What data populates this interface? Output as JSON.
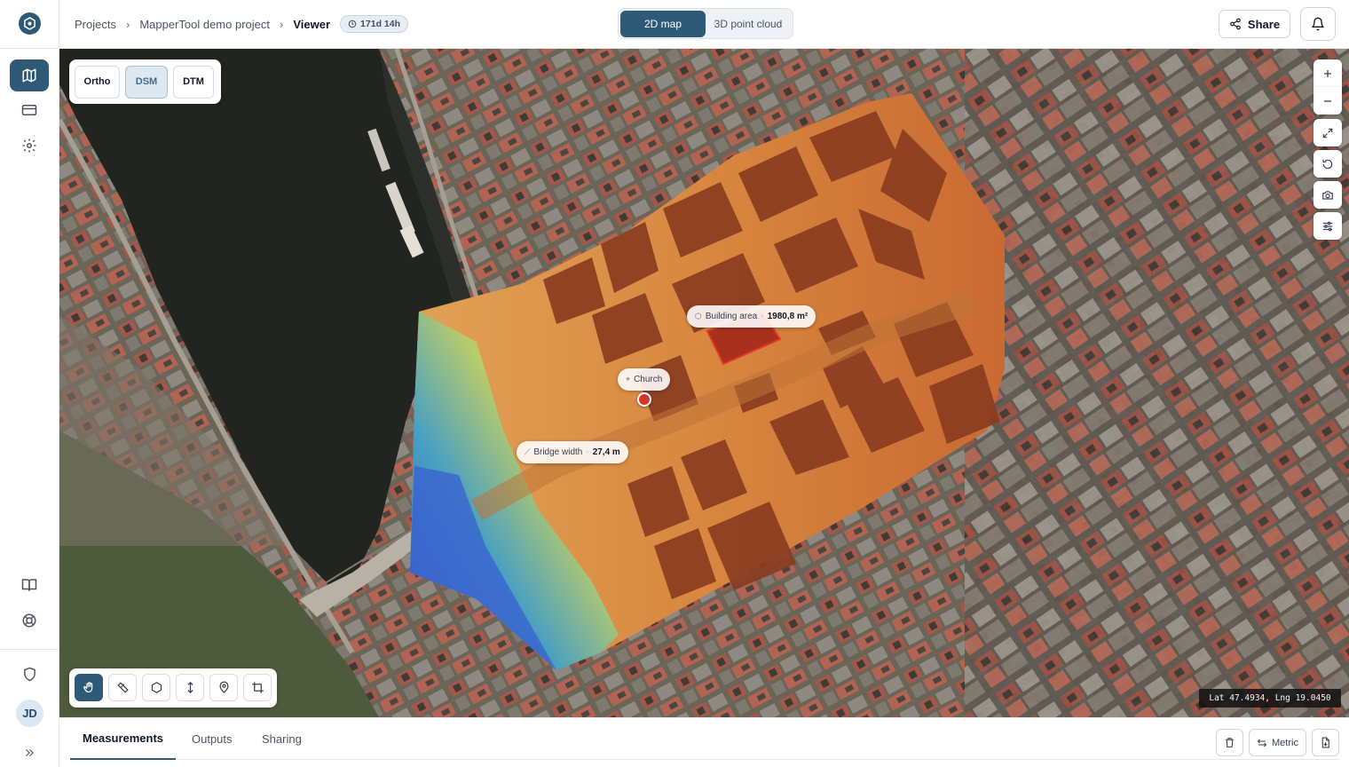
{
  "breadcrumb": {
    "items": [
      "Projects",
      "MapperTool demo project"
    ],
    "current": "Viewer",
    "time_badge": "171d 14h"
  },
  "view_toggle": {
    "options": [
      "2D map",
      "3D point cloud"
    ],
    "selected": "2D map"
  },
  "header": {
    "share_label": "Share"
  },
  "sidebar": {
    "avatar_initials": "JD"
  },
  "layers": {
    "options": [
      "Ortho",
      "DSM",
      "DTM"
    ],
    "selected": "DSM"
  },
  "annotations": {
    "building_area": {
      "label": "Building area",
      "value": "1980,8 m²"
    },
    "church": {
      "label": "Church"
    },
    "bridge_width": {
      "label": "Bridge width",
      "value": "27,4 m"
    }
  },
  "coordinates": "Lat 47.4934, Lng 19.0450",
  "bottom_panel": {
    "tabs": [
      "Measurements",
      "Outputs",
      "Sharing"
    ],
    "active_tab": "Measurements",
    "units_label": "Metric"
  },
  "colors": {
    "accent": "#2f5a77",
    "dsm_high": "#8a3a1e",
    "dsm_mid": "#e09a4e",
    "dsm_low": "#3a63c9",
    "selection": "#d9342b"
  },
  "icons": {
    "sidebar": [
      "map-icon",
      "card-icon",
      "settings-icon",
      "book-icon",
      "help-icon",
      "shield-icon",
      "expand-icon"
    ],
    "map_controls": [
      "zoom-in-icon",
      "zoom-out-icon",
      "fullscreen-icon",
      "reset-icon",
      "camera-icon",
      "sliders-icon"
    ],
    "tools": [
      "hand-icon",
      "ruler-icon",
      "polygon-icon",
      "height-icon",
      "pin-icon",
      "crop-icon"
    ]
  }
}
